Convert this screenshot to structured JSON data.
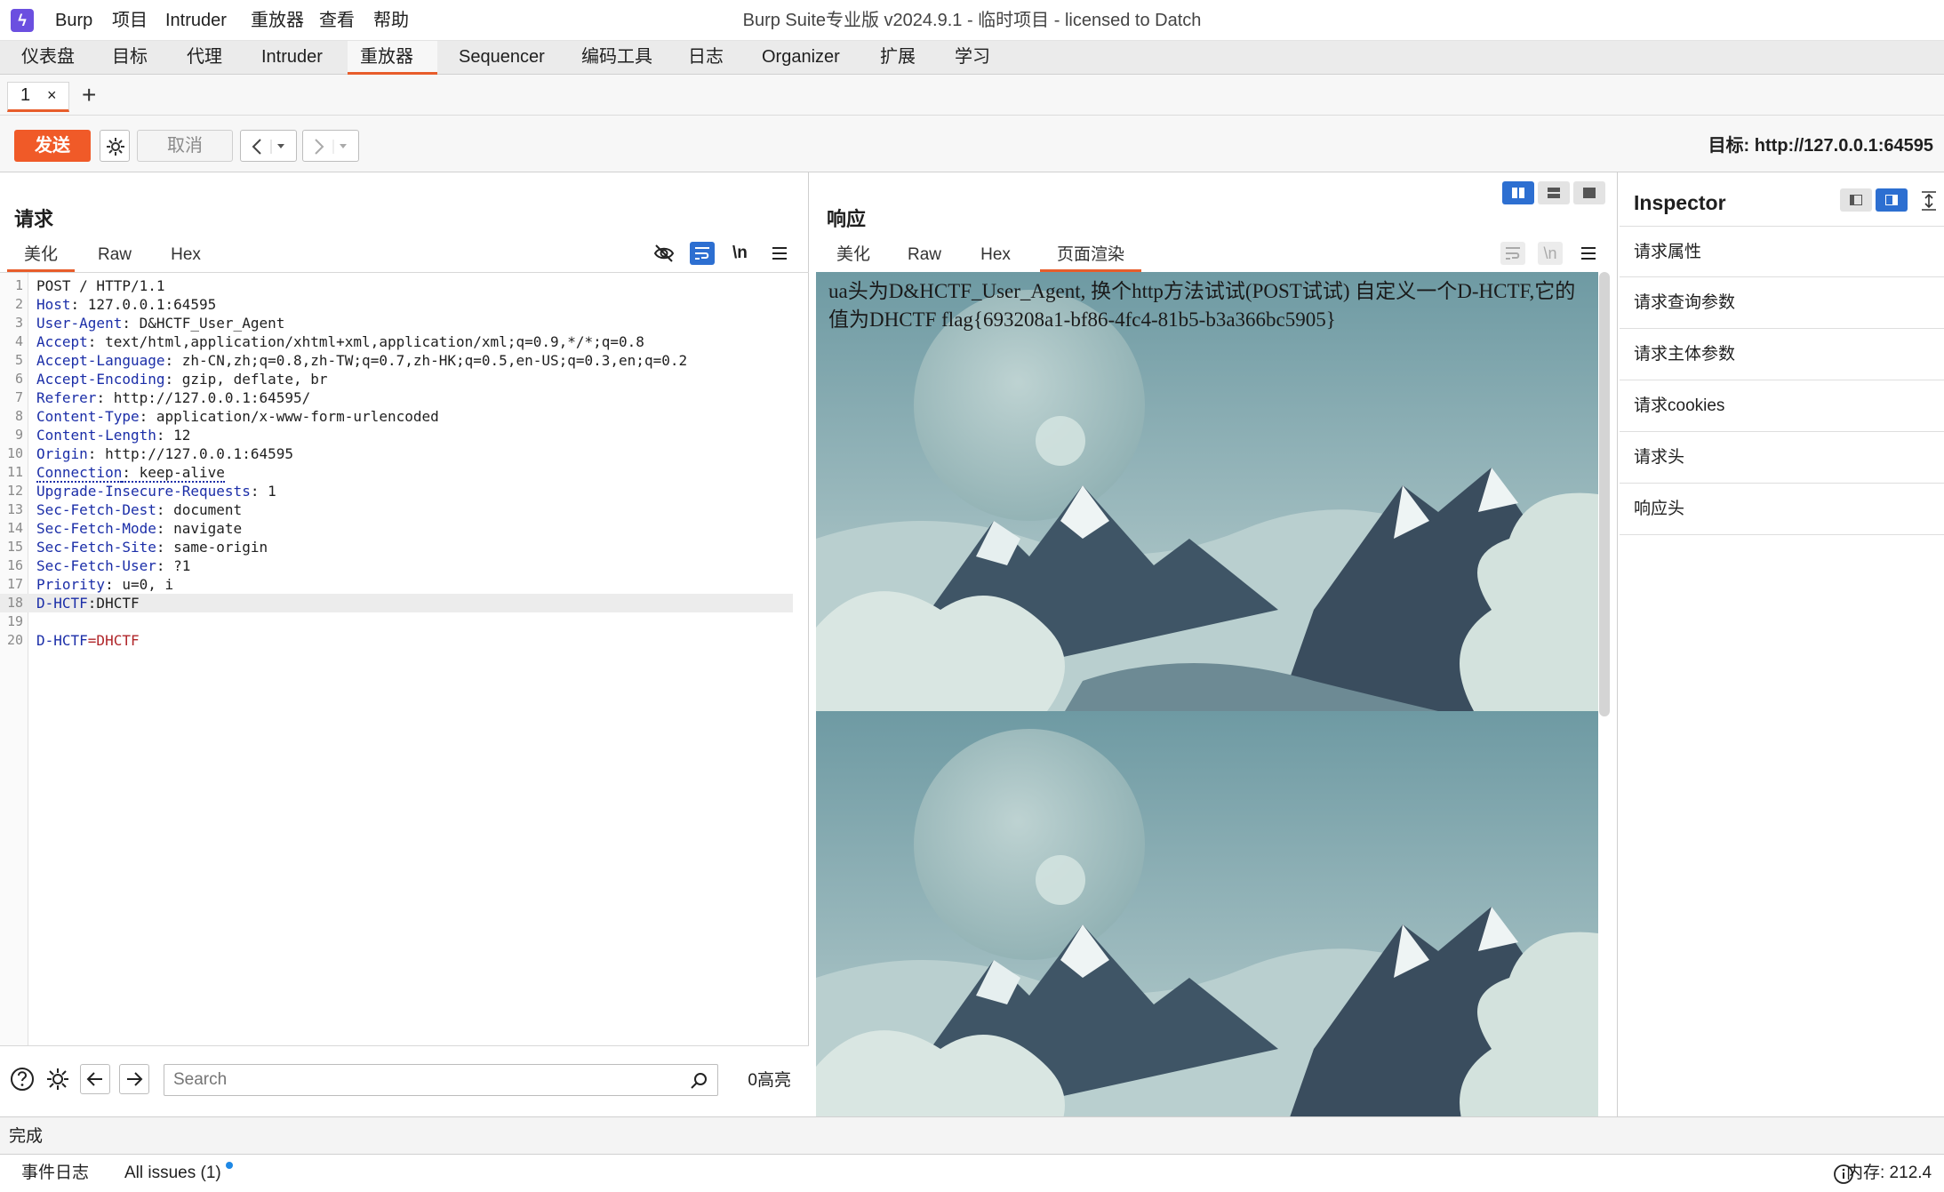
{
  "menu": {
    "items": [
      "Burp",
      "项目",
      "Intruder",
      "重放器",
      "查看",
      "帮助"
    ],
    "window_title": "Burp Suite专业版  v2024.9.1 - 临时项目 - licensed to Datch"
  },
  "main_tabs": [
    "仪表盘",
    "目标",
    "代理",
    "Intruder",
    "重放器",
    "Sequencer",
    "编码工具",
    "日志",
    "Organizer",
    "扩展",
    "学习"
  ],
  "active_main_tab": "重放器",
  "sub_tabs": {
    "tab1_label": "1",
    "close": "×"
  },
  "toolbar": {
    "send_label": "发送",
    "cancel_label": "取消",
    "target": "目标: http://127.0.0.1:64595"
  },
  "request": {
    "title": "请求",
    "tabs": [
      "美化",
      "Raw",
      "Hex"
    ],
    "active_tab": "美化",
    "wrap_label": "\\n",
    "lines": [
      {
        "no": "1",
        "key": "POST / HTTP/1.1",
        "val": ""
      },
      {
        "no": "2",
        "key": "Host",
        "val": ": 127.0.0.1:64595"
      },
      {
        "no": "3",
        "key": "User-Agent",
        "val": ": D&HCTF_User_Agent"
      },
      {
        "no": "4",
        "key": "Accept",
        "val": ": text/html,application/xhtml+xml,application/xml;q=0.9,*/*;q=0.8"
      },
      {
        "no": "5",
        "key": "Accept-Language",
        "val": ": zh-CN,zh;q=0.8,zh-TW;q=0.7,zh-HK;q=0.5,en-US;q=0.3,en;q=0.2"
      },
      {
        "no": "6",
        "key": "Accept-Encoding",
        "val": ": gzip, deflate, br"
      },
      {
        "no": "7",
        "key": "Referer",
        "val": ": http://127.0.0.1:64595/"
      },
      {
        "no": "8",
        "key": "Content-Type",
        "val": ": application/x-www-form-urlencoded"
      },
      {
        "no": "9",
        "key": "Content-Length",
        "val": ": 12"
      },
      {
        "no": "10",
        "key": "Origin",
        "val": ": http://127.0.0.1:64595"
      },
      {
        "no": "11",
        "key": "Connection",
        "val": ": keep-alive"
      },
      {
        "no": "12",
        "key": "Upgrade-Insecure-Requests",
        "val": ": 1"
      },
      {
        "no": "13",
        "key": "Sec-Fetch-Dest",
        "val": ": document"
      },
      {
        "no": "14",
        "key": "Sec-Fetch-Mode",
        "val": ": navigate"
      },
      {
        "no": "15",
        "key": "Sec-Fetch-Site",
        "val": ": same-origin"
      },
      {
        "no": "16",
        "key": "Sec-Fetch-User",
        "val": ": ?1"
      },
      {
        "no": "17",
        "key": "Priority",
        "val": ": u=0, i"
      },
      {
        "no": "18",
        "key": "D-HCTF",
        "val": ":DHCTF"
      },
      {
        "no": "19",
        "key": "",
        "val": ""
      },
      {
        "no": "20",
        "key": "D-HCTF",
        "val": "=DHCTF"
      }
    ],
    "search_placeholder": "Search",
    "highlight_count": "0高亮"
  },
  "response": {
    "title": "响应",
    "tabs": [
      "美化",
      "Raw",
      "Hex",
      "页面渲染"
    ],
    "active_tab": "页面渲染",
    "wrap_label": "\\n",
    "render_text": "ua头为D&HCTF_User_Agent, 换个http方法试试(POST试试) 自定义一个D-HCTF,它的值为DHCTF flag{693208a1-bf86-4fc4-81b5-b3a366bc5905}"
  },
  "inspector": {
    "title": "Inspector",
    "items": [
      "请求属性",
      "请求查询参数",
      "请求主体参数",
      "请求cookies",
      "请求头",
      "响应头"
    ]
  },
  "status": {
    "text": "完成"
  },
  "bottom": {
    "event_log": "事件日志",
    "issues": "All issues (1)",
    "memory": "内存: 212.4"
  },
  "colors": {
    "accent": "#e85d2b",
    "send": "#f05a28",
    "header_key": "#1b2ea8",
    "value_red": "#b0262a",
    "layout_active": "#2d6fd1"
  },
  "icons": [
    "burp-logo-icon",
    "settings-gear-icon",
    "back-arrow-icon",
    "forward-arrow-icon",
    "eye-off-icon",
    "wrap-text-icon",
    "newline-icon",
    "hamburger-menu-icon",
    "help-icon",
    "search-icon",
    "info-icon"
  ]
}
